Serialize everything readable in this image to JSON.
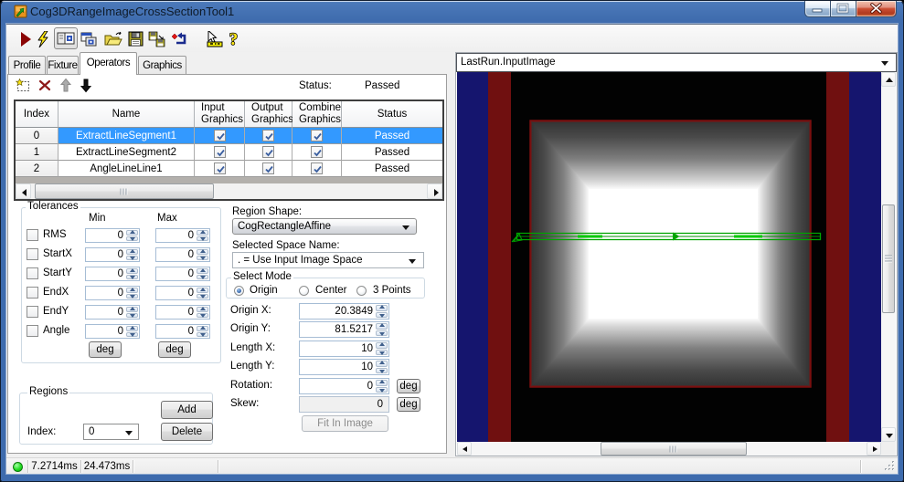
{
  "window": {
    "title": "Cog3DRangeImageCrossSectionTool1",
    "caption_buttons": [
      "minimize",
      "maximize",
      "close"
    ]
  },
  "toolbar": {
    "icons": [
      "run-icon",
      "run-electric-icon",
      "show-last-run-records-icon",
      "show-current-records-icon",
      "open-file-icon",
      "save-icon",
      "save-as-icon",
      "reset-icon",
      "pointer-ruler-icon",
      "help-icon"
    ]
  },
  "tabs": {
    "items": [
      {
        "label": "Profile"
      },
      {
        "label": "Fixture"
      },
      {
        "label": "Operators",
        "active": true
      },
      {
        "label": "Graphics"
      }
    ]
  },
  "operators": {
    "toolbar_icons": [
      "add-operator-icon",
      "delete-operator-icon",
      "move-up-icon",
      "move-down-icon"
    ],
    "status_label": "Status:",
    "status_value": "Passed",
    "grid": {
      "columns": [
        "Index",
        "Name",
        "Input Graphics",
        "Output Graphics",
        "Combine Graphics",
        "Status"
      ],
      "rows": [
        {
          "index": "0",
          "name": "ExtractLineSegment1",
          "input_graphics": true,
          "output_graphics": true,
          "combine_graphics": true,
          "status": "Passed",
          "selected": true
        },
        {
          "index": "1",
          "name": "ExtractLineSegment2",
          "input_graphics": true,
          "output_graphics": true,
          "combine_graphics": true,
          "status": "Passed",
          "selected": false
        },
        {
          "index": "2",
          "name": "AngleLineLine1",
          "input_graphics": true,
          "output_graphics": true,
          "combine_graphics": true,
          "status": "Passed",
          "selected": false
        }
      ]
    }
  },
  "tolerances": {
    "title": "Tolerances",
    "min_header": "Min",
    "max_header": "Max",
    "rows": [
      {
        "label": "RMS",
        "checked": false,
        "min": "0",
        "max": "0"
      },
      {
        "label": "StartX",
        "checked": false,
        "min": "0",
        "max": "0"
      },
      {
        "label": "StartY",
        "checked": false,
        "min": "0",
        "max": "0"
      },
      {
        "label": "EndX",
        "checked": false,
        "min": "0",
        "max": "0"
      },
      {
        "label": "EndY",
        "checked": false,
        "min": "0",
        "max": "0"
      },
      {
        "label": "Angle",
        "checked": false,
        "min": "0",
        "max": "0"
      }
    ],
    "deg_label": "deg"
  },
  "region_editor": {
    "region_shape_label": "Region Shape:",
    "region_shape_value": "CogRectangleAffine",
    "space_name_label": "Selected Space Name:",
    "space_name_value": ". = Use Input Image Space",
    "select_mode": {
      "title": "Select Mode",
      "options": [
        "Origin",
        "Center",
        "3 Points"
      ],
      "selected": "Origin"
    },
    "fields": [
      {
        "label": "Origin X:",
        "value": "20.3849"
      },
      {
        "label": "Origin Y:",
        "value": "81.5217"
      },
      {
        "label": "Length X:",
        "value": "10"
      },
      {
        "label": "Length Y:",
        "value": "10"
      },
      {
        "label": "Rotation:",
        "value": "0"
      },
      {
        "label": "Skew:",
        "value": "0",
        "disabled": true
      }
    ],
    "deg_label": "deg",
    "fit_button_label": "Fit In Image",
    "fit_button_disabled": true
  },
  "regions": {
    "title": "Regions",
    "index_label": "Index:",
    "index_value": "0",
    "add_label": "Add",
    "delete_label": "Delete"
  },
  "display": {
    "source_selector": "LastRun.InputImage",
    "image": {
      "description": "3D range image: dark scene, blue and dark-red vertical bars on both sides, centered gray square with bright pyramid plateau, red outline, green cross-section line overlay",
      "background": "#020202",
      "bar_blue": "#15156E",
      "bar_red": "#701010",
      "square_border_red": "#7A0F0F",
      "overlay_green": "#00A400"
    }
  },
  "statusbar": {
    "run_time": "7.2714ms",
    "total_time": "24.473ms"
  },
  "colors": {
    "selection": "#3399FF",
    "titlebar_blue": "#3E6BAD",
    "led_green": "#22DD22"
  }
}
